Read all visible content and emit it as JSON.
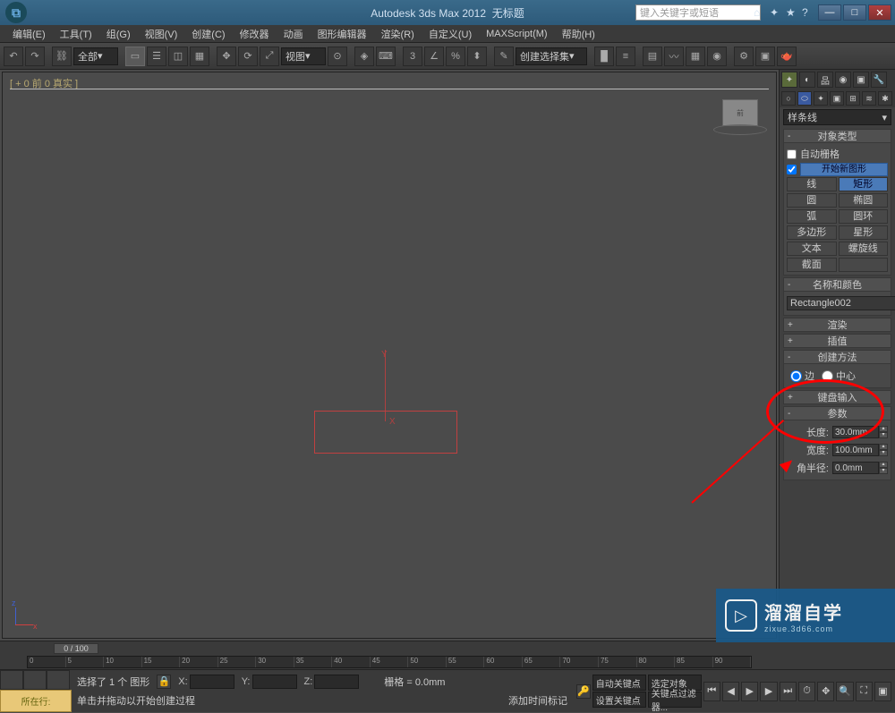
{
  "title": {
    "app": "Autodesk 3ds Max  2012",
    "doc": "无标题"
  },
  "search_placeholder": "键入关键字或短语",
  "menu": [
    "编辑(E)",
    "工具(T)",
    "组(G)",
    "视图(V)",
    "创建(C)",
    "修改器",
    "动画",
    "图形编辑器",
    "渲染(R)",
    "自定义(U)",
    "MAXScript(M)",
    "帮助(H)"
  ],
  "toolbar": {
    "all_dd": "全部",
    "view_dd": "视图",
    "sel_dd": "创建选择集"
  },
  "viewport": {
    "label": "[ + 0 前 0 真实 ]",
    "axis_y": "Y",
    "axis_x": "X"
  },
  "rpanel": {
    "dropdown": "样条线",
    "rollouts": {
      "obj_type": "对象类型",
      "auto_grid": "自动栅格",
      "new_shape": "开始新图形",
      "name_color": "名称和颜色",
      "render": "渲染",
      "interp": "插值",
      "create_method": "创建方法",
      "keyboard": "键盘输入",
      "params": "参数"
    },
    "shapes": [
      {
        "l": "线",
        "r": "矩形"
      },
      {
        "l": "圆",
        "r": "椭圆"
      },
      {
        "l": "弧",
        "r": "圆环"
      },
      {
        "l": "多边形",
        "r": "星形"
      },
      {
        "l": "文本",
        "r": "螺旋线"
      },
      {
        "l": "截面",
        "r": ""
      }
    ],
    "radio": {
      "edge": "边",
      "center": "中心"
    },
    "object_name": "Rectangle002",
    "params": {
      "length_lbl": "长度:",
      "length_val": "30.0mm",
      "width_lbl": "宽度:",
      "width_val": "100.0mm",
      "radius_lbl": "角半径:",
      "radius_val": "0.0mm"
    }
  },
  "timeline": {
    "slider": "0 / 100",
    "ticks": [
      "0",
      "5",
      "10",
      "15",
      "20",
      "25",
      "30",
      "35",
      "40",
      "45",
      "50",
      "55",
      "60",
      "65",
      "70",
      "75",
      "80",
      "85",
      "90"
    ]
  },
  "status": {
    "sel_text": "选择了 1 个 图形",
    "hint": "单击并拖动以开始创建过程",
    "loc_btn": "所在行:",
    "grid_lbl": "栅格 = 0.0mm",
    "x": "X:",
    "y": "Y:",
    "z": "Z:",
    "autokey": "自动关键点",
    "setkey": "设置关键点",
    "selfilter": "选定对象",
    "keyfilter": "关键点过滤器...",
    "addtime": "添加时间标记"
  },
  "watermark": {
    "big": "溜溜自学",
    "small": "zixue.3d66.com"
  }
}
